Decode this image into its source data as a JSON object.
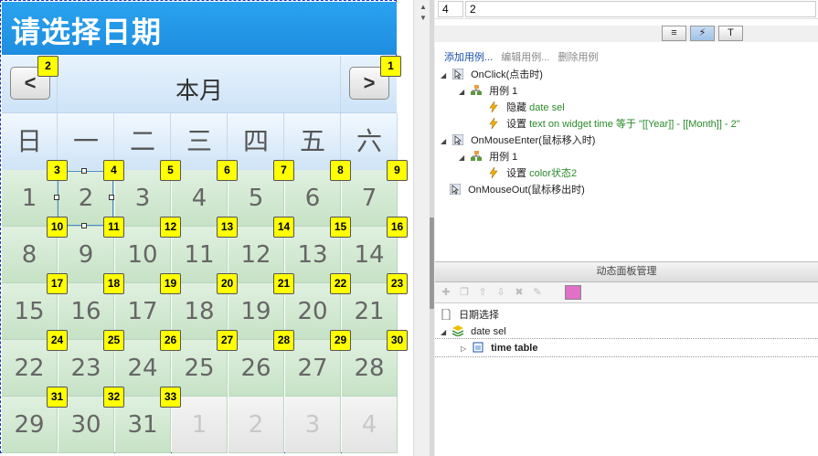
{
  "calendar": {
    "title": "请选择日期",
    "month_label": "本月",
    "prev_label": "<",
    "next_label": ">",
    "prev_marker": "2",
    "next_marker": "1",
    "weekdays": [
      "日",
      "一",
      "二",
      "三",
      "四",
      "五",
      "六"
    ],
    "rows": [
      [
        {
          "d": "1",
          "m": "3",
          "o": false
        },
        {
          "d": "2",
          "m": "4",
          "o": false
        },
        {
          "d": "3",
          "m": "5",
          "o": false
        },
        {
          "d": "4",
          "m": "6",
          "o": false
        },
        {
          "d": "5",
          "m": "7",
          "o": false
        },
        {
          "d": "6",
          "m": "8",
          "o": false
        },
        {
          "d": "7",
          "m": "9",
          "o": false
        }
      ],
      [
        {
          "d": "8",
          "m": "10",
          "o": false
        },
        {
          "d": "9",
          "m": "11",
          "o": false
        },
        {
          "d": "10",
          "m": "12",
          "o": false
        },
        {
          "d": "11",
          "m": "13",
          "o": false
        },
        {
          "d": "12",
          "m": "14",
          "o": false
        },
        {
          "d": "13",
          "m": "15",
          "o": false
        },
        {
          "d": "14",
          "m": "16",
          "o": false
        }
      ],
      [
        {
          "d": "15",
          "m": "17",
          "o": false
        },
        {
          "d": "16",
          "m": "18",
          "o": false
        },
        {
          "d": "17",
          "m": "19",
          "o": false
        },
        {
          "d": "18",
          "m": "20",
          "o": false
        },
        {
          "d": "19",
          "m": "21",
          "o": false
        },
        {
          "d": "20",
          "m": "22",
          "o": false
        },
        {
          "d": "21",
          "m": "23",
          "o": false
        }
      ],
      [
        {
          "d": "22",
          "m": "24",
          "o": false
        },
        {
          "d": "23",
          "m": "25",
          "o": false
        },
        {
          "d": "24",
          "m": "26",
          "o": false
        },
        {
          "d": "25",
          "m": "27",
          "o": false
        },
        {
          "d": "26",
          "m": "28",
          "o": false
        },
        {
          "d": "27",
          "m": "29",
          "o": false
        },
        {
          "d": "28",
          "m": "30",
          "o": false
        }
      ],
      [
        {
          "d": "29",
          "m": "31",
          "o": false
        },
        {
          "d": "30",
          "m": "32",
          "o": false
        },
        {
          "d": "31",
          "m": "33",
          "o": false
        },
        {
          "d": "1",
          "m": "",
          "o": true
        },
        {
          "d": "2",
          "m": "",
          "o": true
        },
        {
          "d": "3",
          "m": "",
          "o": true
        },
        {
          "d": "4",
          "m": "",
          "o": true
        }
      ]
    ]
  },
  "inputs": {
    "a": "4",
    "b": "2"
  },
  "interactions": {
    "add_case": "添加用例...",
    "edit_case": "编辑用例...",
    "delete_case": "删除用例",
    "onclick": "OnClick(点击时)",
    "case1": "用例 1",
    "hide_verb": "隐藏",
    "hide_target": "date sel",
    "set_verb": "设置",
    "set_text": "text on widget time 等于 \"[[Year]] - [[Month]] - 2\"",
    "onmouseenter": "OnMouseEnter(鼠标移入时)",
    "case1b": "用例 1",
    "set_verb2": "设置",
    "set_color": "color状态2",
    "onmouseout": "OnMouseOut(鼠标移出时)"
  },
  "dynamic_panel": {
    "title": "动态面板管理",
    "root": "日期选择",
    "panel": "date sel",
    "state": "time table"
  },
  "colors": {
    "accent": "#1e8de0",
    "marker": "#ffff00",
    "cell": "#d4ead4",
    "link_green": "#2a8a2a"
  }
}
